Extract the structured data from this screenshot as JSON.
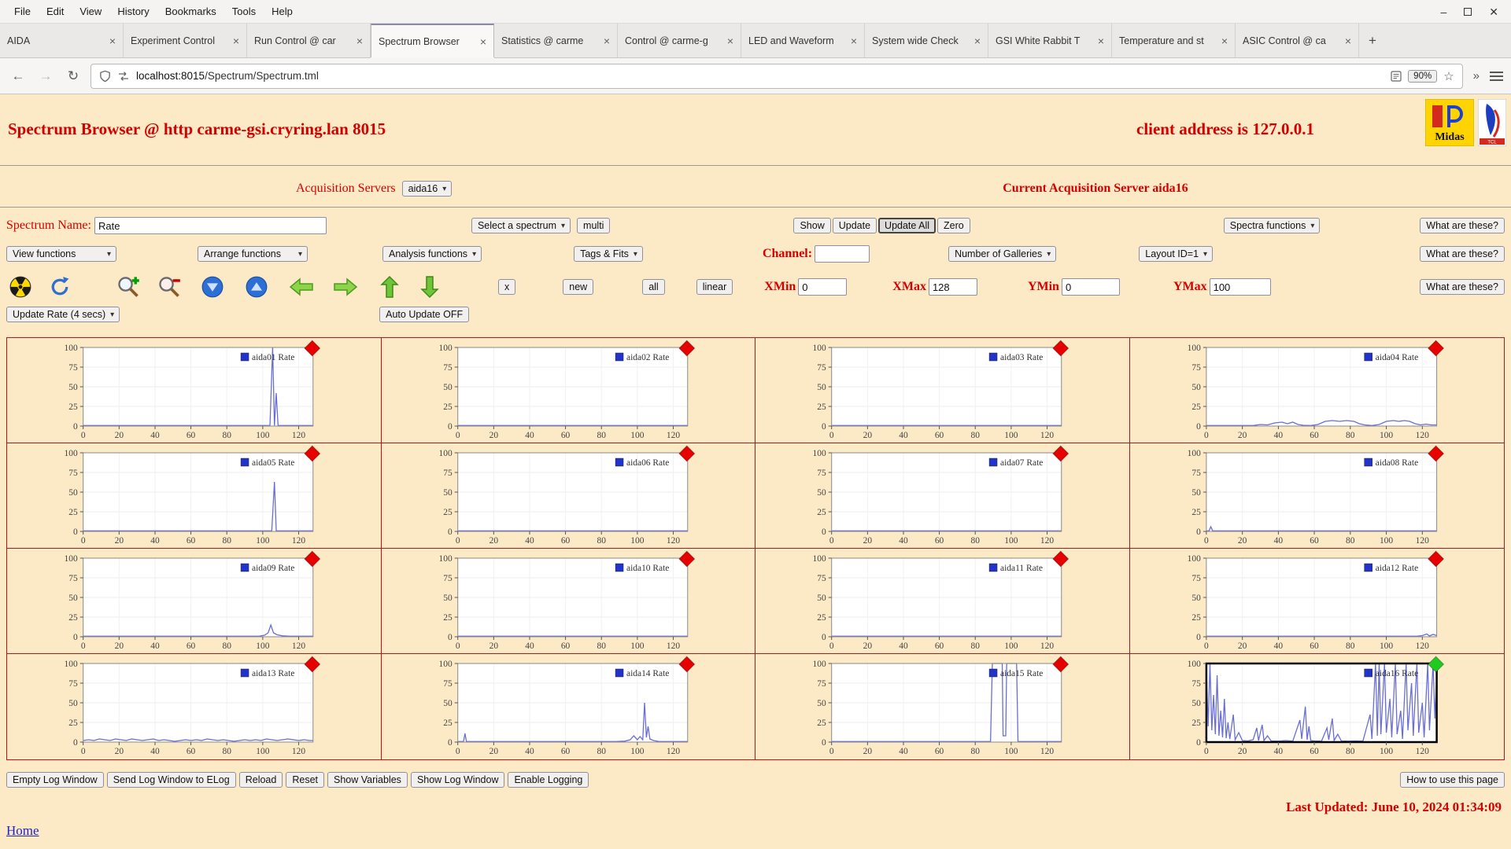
{
  "browser": {
    "menu": [
      "File",
      "Edit",
      "View",
      "History",
      "Bookmarks",
      "Tools",
      "Help"
    ],
    "tabs": [
      {
        "label": "AIDA",
        "active": false
      },
      {
        "label": "Experiment Control",
        "active": false
      },
      {
        "label": "Run Control @ car",
        "active": false
      },
      {
        "label": "Spectrum Browser",
        "active": true
      },
      {
        "label": "Statistics @ carme",
        "active": false
      },
      {
        "label": "Control @ carme-g",
        "active": false
      },
      {
        "label": "LED and Waveform",
        "active": false
      },
      {
        "label": "System wide Check",
        "active": false
      },
      {
        "label": "GSI White Rabbit T",
        "active": false
      },
      {
        "label": "Temperature and st",
        "active": false
      },
      {
        "label": "ASIC Control @ ca",
        "active": false
      }
    ],
    "new_tab": "+",
    "url_host": "localhost:8015",
    "url_path": "/Spectrum/Spectrum.tml",
    "zoom": "90%"
  },
  "header": {
    "title": "Spectrum Browser @ http carme-gsi.cryring.lan 8015",
    "client": "client address is 127.0.0.1",
    "midas_logo_text": "Midas",
    "tcl_logo_text": "TCL"
  },
  "acquisition": {
    "label": "Acquisition Servers",
    "server": "aida16",
    "current": "Current Acquisition Server aida16"
  },
  "controls": {
    "spectrum_name_label": "Spectrum Name:",
    "spectrum_name_value": "Rate",
    "select_spectrum": "Select a spectrum",
    "multi": "multi",
    "show": "Show",
    "update": "Update",
    "update_all": "Update All",
    "zero": "Zero",
    "spectra_functions": "Spectra functions",
    "what_are_these": "What are these?",
    "view_functions": "View functions",
    "arrange_functions": "Arrange functions",
    "analysis_functions": "Analysis functions",
    "tags_fits": "Tags & Fits",
    "channel_label": "Channel:",
    "channel_value": "",
    "galleries": "Number of Galleries",
    "layout": "Layout ID=1",
    "x_btn": "x",
    "new_btn": "new",
    "all_btn": "all",
    "linear_btn": "linear",
    "xmin_label": "XMin",
    "xmin_value": "0",
    "xmax_label": "XMax",
    "xmax_value": "128",
    "ymin_label": "YMin",
    "ymin_value": "0",
    "ymax_label": "YMax",
    "ymax_value": "100",
    "update_rate": "Update Rate (4 secs)",
    "auto_update": "Auto Update OFF"
  },
  "icons": [
    "radiation-icon",
    "refresh-icon",
    "zoom-in-icon",
    "zoom-out-icon",
    "compress-y-icon",
    "expand-y-icon",
    "shift-left-icon",
    "shift-right-icon",
    "expand-x-icon",
    "compress-x-icon"
  ],
  "footer": {
    "buttons": [
      "Empty Log Window",
      "Send Log Window to ELog",
      "Reload",
      "Reset",
      "Show Variables",
      "Show Log Window",
      "Enable Logging"
    ],
    "help": "How to use this page",
    "last_updated": "Last Updated: June 10, 2024 01:34:09",
    "home": "Home"
  },
  "chart_data": {
    "type": "line",
    "xlim": [
      0,
      128
    ],
    "ylim": [
      0,
      100
    ],
    "xticks": [
      0,
      20,
      40,
      60,
      80,
      100,
      120
    ],
    "yticks": [
      0,
      25,
      50,
      75,
      100
    ],
    "xlabel": "",
    "ylabel": "",
    "line_color": "#6a6ed2",
    "legend_square_color": "#2233cc",
    "marker_red": "#e60000",
    "marker_green": "#1ecb1e",
    "charts": [
      {
        "name": "aida01 Rate",
        "selected": false,
        "marker": "#e60000",
        "points": [
          [
            0,
            0.7
          ],
          [
            104,
            0.7
          ],
          [
            105.5,
            100
          ],
          [
            106.5,
            0.7
          ],
          [
            107.5,
            42
          ],
          [
            108.5,
            0.7
          ],
          [
            128,
            0.7
          ]
        ]
      },
      {
        "name": "aida02 Rate",
        "selected": false,
        "marker": "#e60000",
        "points": [
          [
            0,
            0.7
          ],
          [
            128,
            0.7
          ]
        ]
      },
      {
        "name": "aida03 Rate",
        "selected": false,
        "marker": "#e60000",
        "points": [
          [
            0,
            0.7
          ],
          [
            128,
            0.7
          ]
        ]
      },
      {
        "name": "aida04 Rate",
        "selected": false,
        "marker": "#e60000",
        "points": [
          [
            0,
            0.7
          ],
          [
            26,
            0.7
          ],
          [
            30,
            2
          ],
          [
            34,
            1.5
          ],
          [
            38,
            4
          ],
          [
            42,
            5
          ],
          [
            45,
            3
          ],
          [
            48,
            5
          ],
          [
            51,
            2
          ],
          [
            54,
            1
          ],
          [
            58,
            0.7
          ],
          [
            62,
            2
          ],
          [
            66,
            6
          ],
          [
            70,
            7
          ],
          [
            74,
            6
          ],
          [
            78,
            7
          ],
          [
            82,
            6
          ],
          [
            85,
            3
          ],
          [
            88,
            1.5
          ],
          [
            92,
            0.7
          ],
          [
            96,
            2
          ],
          [
            100,
            6
          ],
          [
            104,
            7
          ],
          [
            107,
            6
          ],
          [
            110,
            7
          ],
          [
            113,
            6
          ],
          [
            116,
            3
          ],
          [
            119,
            1.5
          ],
          [
            122,
            2.5
          ],
          [
            125,
            1.5
          ],
          [
            128,
            1.5
          ]
        ]
      },
      {
        "name": "aida05 Rate",
        "selected": false,
        "marker": "#e60000",
        "points": [
          [
            0,
            0.7
          ],
          [
            105,
            0.7
          ],
          [
            106.5,
            63
          ],
          [
            107.5,
            0.7
          ],
          [
            128,
            0.7
          ]
        ]
      },
      {
        "name": "aida06 Rate",
        "selected": false,
        "marker": "#e60000",
        "points": [
          [
            0,
            0.7
          ],
          [
            128,
            0.7
          ]
        ]
      },
      {
        "name": "aida07 Rate",
        "selected": false,
        "marker": "#e60000",
        "points": [
          [
            0,
            0.7
          ],
          [
            128,
            0.7
          ]
        ]
      },
      {
        "name": "aida08 Rate",
        "selected": false,
        "marker": "#e60000",
        "points": [
          [
            0,
            0.7
          ],
          [
            1.5,
            0.7
          ],
          [
            2.5,
            6
          ],
          [
            3.5,
            0.7
          ],
          [
            128,
            0.7
          ]
        ]
      },
      {
        "name": "aida09 Rate",
        "selected": false,
        "marker": "#e60000",
        "points": [
          [
            0,
            0.7
          ],
          [
            98,
            0.7
          ],
          [
            101,
            2
          ],
          [
            103,
            5
          ],
          [
            104.5,
            15
          ],
          [
            106,
            5
          ],
          [
            108,
            2.5
          ],
          [
            111,
            1.2
          ],
          [
            115,
            0.7
          ],
          [
            128,
            0.7
          ]
        ]
      },
      {
        "name": "aida10 Rate",
        "selected": false,
        "marker": "#e60000",
        "points": [
          [
            0,
            0.7
          ],
          [
            128,
            0.7
          ]
        ]
      },
      {
        "name": "aida11 Rate",
        "selected": false,
        "marker": "#e60000",
        "points": [
          [
            0,
            0.7
          ],
          [
            128,
            0.7
          ]
        ]
      },
      {
        "name": "aida12 Rate",
        "selected": false,
        "marker": "#e60000",
        "points": [
          [
            0,
            0.7
          ],
          [
            117,
            0.7
          ],
          [
            120,
            1.5
          ],
          [
            122.5,
            3.5
          ],
          [
            124,
            1
          ],
          [
            126,
            3
          ],
          [
            128,
            1.5
          ]
        ]
      },
      {
        "name": "aida13 Rate",
        "selected": false,
        "marker": "#e60000",
        "points": [
          [
            0,
            2
          ],
          [
            3,
            3
          ],
          [
            6,
            2
          ],
          [
            9,
            4
          ],
          [
            12,
            3
          ],
          [
            15,
            2
          ],
          [
            18,
            4
          ],
          [
            21,
            3
          ],
          [
            24,
            2
          ],
          [
            27,
            4
          ],
          [
            30,
            3
          ],
          [
            33,
            2
          ],
          [
            36,
            3
          ],
          [
            39,
            4
          ],
          [
            42,
            2
          ],
          [
            45,
            3
          ],
          [
            48,
            2
          ],
          [
            51,
            1
          ],
          [
            54,
            2
          ],
          [
            57,
            3
          ],
          [
            60,
            2
          ],
          [
            63,
            3
          ],
          [
            66,
            2
          ],
          [
            69,
            4
          ],
          [
            72,
            3
          ],
          [
            75,
            2
          ],
          [
            78,
            3
          ],
          [
            81,
            2
          ],
          [
            84,
            1
          ],
          [
            87,
            2
          ],
          [
            90,
            3
          ],
          [
            93,
            2
          ],
          [
            96,
            3
          ],
          [
            99,
            2
          ],
          [
            102,
            4
          ],
          [
            105,
            3
          ],
          [
            108,
            2
          ],
          [
            111,
            3
          ],
          [
            114,
            4
          ],
          [
            117,
            3
          ],
          [
            120,
            2
          ],
          [
            123,
            3
          ],
          [
            126,
            2
          ],
          [
            128,
            2
          ]
        ]
      },
      {
        "name": "aida14 Rate",
        "selected": false,
        "marker": "#e60000",
        "points": [
          [
            0,
            0.7
          ],
          [
            3.2,
            0.7
          ],
          [
            4,
            11
          ],
          [
            4.8,
            0.7
          ],
          [
            88,
            0.7
          ],
          [
            93,
            1.2
          ],
          [
            96,
            3
          ],
          [
            98,
            8
          ],
          [
            100,
            3
          ],
          [
            101.5,
            7
          ],
          [
            103,
            3
          ],
          [
            104,
            50
          ],
          [
            105,
            6
          ],
          [
            106,
            20
          ],
          [
            107,
            4
          ],
          [
            109,
            2
          ],
          [
            112,
            0.7
          ],
          [
            128,
            0.7
          ]
        ]
      },
      {
        "name": "aida15 Rate",
        "selected": false,
        "marker": "#e60000",
        "points": [
          [
            0,
            0.7
          ],
          [
            88.5,
            0.7
          ],
          [
            89.5,
            100
          ],
          [
            95,
            100
          ],
          [
            95.5,
            8
          ],
          [
            97,
            8
          ],
          [
            97.5,
            100
          ],
          [
            103,
            100
          ],
          [
            103.8,
            0.7
          ],
          [
            128,
            0.7
          ]
        ]
      },
      {
        "name": "aida16 Rate",
        "selected": true,
        "marker": "#1ecb1e",
        "points": [
          [
            0,
            95
          ],
          [
            1,
            20
          ],
          [
            2,
            100
          ],
          [
            3,
            15
          ],
          [
            4,
            60
          ],
          [
            5,
            10
          ],
          [
            6,
            85
          ],
          [
            7,
            8
          ],
          [
            8,
            40
          ],
          [
            9,
            6
          ],
          [
            10,
            55
          ],
          [
            11,
            5
          ],
          [
            12,
            25
          ],
          [
            13,
            4
          ],
          [
            15,
            35
          ],
          [
            16,
            3
          ],
          [
            18,
            12
          ],
          [
            20,
            2
          ],
          [
            23,
            1.5
          ],
          [
            26,
            3
          ],
          [
            28,
            18
          ],
          [
            29,
            2
          ],
          [
            31,
            22
          ],
          [
            32,
            2
          ],
          [
            34,
            8
          ],
          [
            36,
            1.5
          ],
          [
            40,
            1.2
          ],
          [
            44,
            2
          ],
          [
            48,
            1.2
          ],
          [
            52,
            28
          ],
          [
            53,
            4
          ],
          [
            55,
            45
          ],
          [
            56,
            3
          ],
          [
            57,
            20
          ],
          [
            58,
            2
          ],
          [
            60,
            1.5
          ],
          [
            64,
            1.2
          ],
          [
            67,
            18
          ],
          [
            68,
            3
          ],
          [
            70,
            30
          ],
          [
            71,
            2
          ],
          [
            73,
            10
          ],
          [
            75,
            1.5
          ],
          [
            79,
            1.2
          ],
          [
            83,
            1.5
          ],
          [
            87,
            1.2
          ],
          [
            91,
            35
          ],
          [
            92,
            4
          ],
          [
            94,
            100
          ],
          [
            95,
            8
          ],
          [
            96,
            100
          ],
          [
            97,
            10
          ],
          [
            99,
            100
          ],
          [
            100,
            12
          ],
          [
            102,
            55
          ],
          [
            103,
            6
          ],
          [
            105,
            100
          ],
          [
            106,
            10
          ],
          [
            108,
            40
          ],
          [
            109,
            4
          ],
          [
            111,
            100
          ],
          [
            112,
            15
          ],
          [
            114,
            75
          ],
          [
            115,
            8
          ],
          [
            117,
            100
          ],
          [
            118,
            12
          ],
          [
            120,
            50
          ],
          [
            121,
            6
          ],
          [
            123,
            100
          ],
          [
            124,
            15
          ],
          [
            126,
            100
          ],
          [
            127,
            30
          ],
          [
            128,
            85
          ]
        ]
      }
    ]
  }
}
